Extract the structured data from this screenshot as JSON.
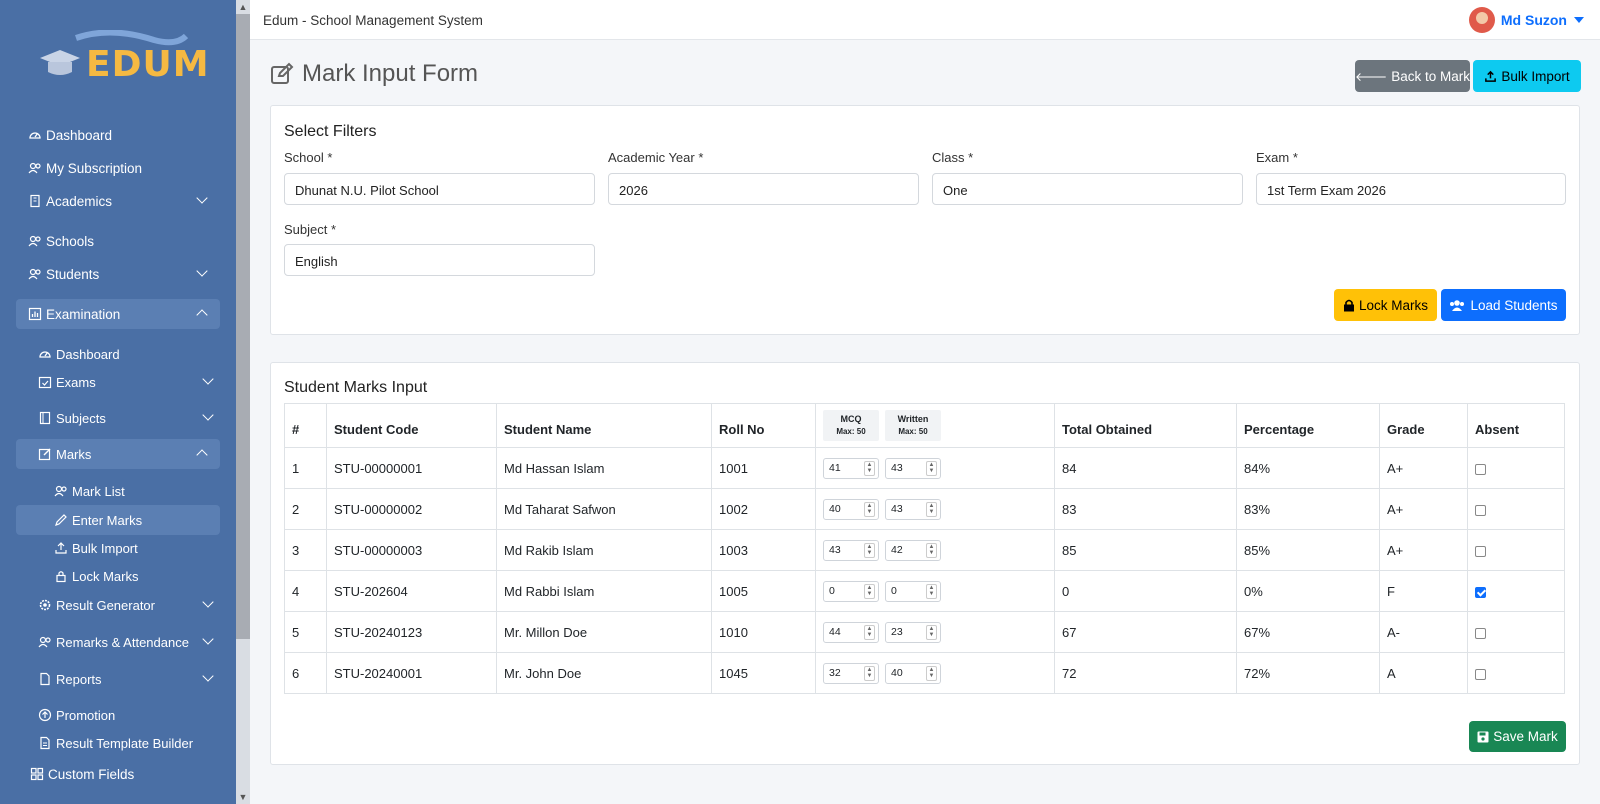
{
  "app_title": "Edum - School Management System",
  "logo_text": "EDUM",
  "user": {
    "name": "Md Suzon"
  },
  "sidebar": {
    "items": [
      {
        "label": "Dashboard"
      },
      {
        "label": "My Subscription"
      },
      {
        "label": "Academics"
      },
      {
        "label": "Schools"
      },
      {
        "label": "Students"
      },
      {
        "label": "Examination"
      },
      {
        "label": "Dashboard"
      },
      {
        "label": "Exams"
      },
      {
        "label": "Subjects"
      },
      {
        "label": "Marks"
      },
      {
        "label": "Mark List"
      },
      {
        "label": "Enter Marks"
      },
      {
        "label": "Bulk Import"
      },
      {
        "label": "Lock Marks"
      },
      {
        "label": "Result Generator"
      },
      {
        "label": "Remarks & Attendance"
      },
      {
        "label": "Reports"
      },
      {
        "label": "Promotion"
      },
      {
        "label": "Result Template Builder"
      },
      {
        "label": "Custom Fields"
      }
    ]
  },
  "page": {
    "title": "Mark Input Form",
    "back_label": "Back to Mark",
    "bulk_label": "Bulk Import"
  },
  "filters": {
    "title": "Select Filters",
    "school": {
      "label": "School *",
      "value": "Dhunat N.U. Pilot School"
    },
    "year": {
      "label": "Academic Year *",
      "value": "2026"
    },
    "class": {
      "label": "Class *",
      "value": "One"
    },
    "exam": {
      "label": "Exam *",
      "value": "1st Term Exam 2026"
    },
    "subject": {
      "label": "Subject *",
      "value": "English"
    },
    "lock_label": "Lock Marks",
    "load_label": "Load Students"
  },
  "marks": {
    "title": "Student Marks Input",
    "headers": {
      "num": "#",
      "code": "Student Code",
      "name": "Student Name",
      "roll": "Roll No",
      "mcq": "MCQ",
      "mcq_max": "Max: 50",
      "written": "Written",
      "written_max": "Max: 50",
      "total": "Total Obtained",
      "pct": "Percentage",
      "grade": "Grade",
      "absent": "Absent"
    },
    "rows": [
      {
        "n": "1",
        "code": "STU-00000001",
        "name": "Md Hassan Islam",
        "roll": "1001",
        "mcq": "41",
        "written": "43",
        "total": "84",
        "pct": "84%",
        "grade": "A+",
        "absent": false
      },
      {
        "n": "2",
        "code": "STU-00000002",
        "name": "Md Taharat Safwon",
        "roll": "1002",
        "mcq": "40",
        "written": "43",
        "total": "83",
        "pct": "83%",
        "grade": "A+",
        "absent": false
      },
      {
        "n": "3",
        "code": "STU-00000003",
        "name": "Md Rakib Islam",
        "roll": "1003",
        "mcq": "43",
        "written": "42",
        "total": "85",
        "pct": "85%",
        "grade": "A+",
        "absent": false
      },
      {
        "n": "4",
        "code": "STU-202604",
        "name": "Md Rabbi Islam",
        "roll": "1005",
        "mcq": "0",
        "written": "0",
        "total": "0",
        "pct": "0%",
        "grade": "F",
        "absent": true
      },
      {
        "n": "5",
        "code": "STU-20240123",
        "name": "Mr. Millon Doe",
        "roll": "1010",
        "mcq": "44",
        "written": "23",
        "total": "67",
        "pct": "67%",
        "grade": "A-",
        "absent": false
      },
      {
        "n": "6",
        "code": "STU-20240001",
        "name": "Mr. John Doe",
        "roll": "1045",
        "mcq": "32",
        "written": "40",
        "total": "72",
        "pct": "72%",
        "grade": "A",
        "absent": false
      }
    ],
    "save_label": "Save Mark"
  }
}
